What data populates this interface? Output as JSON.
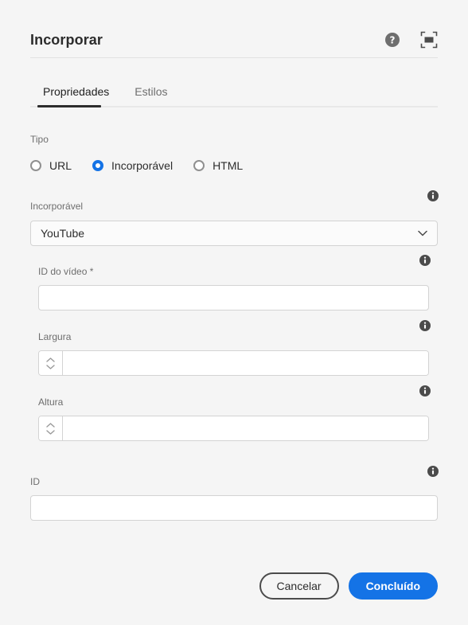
{
  "dialog": {
    "title": "Incorporar",
    "help_icon": "help-circle-icon",
    "fullscreen_icon": "fullscreen-icon"
  },
  "tabs": [
    {
      "label": "Propriedades",
      "active": true
    },
    {
      "label": "Estilos",
      "active": false
    }
  ],
  "type_group": {
    "label": "Tipo",
    "options": [
      {
        "label": "URL",
        "selected": false
      },
      {
        "label": "Incorporável",
        "selected": true
      },
      {
        "label": "HTML",
        "selected": false
      }
    ]
  },
  "fields": {
    "embeddable": {
      "label": "Incorporável",
      "value": "YouTube",
      "chevron": "chevron-down-icon",
      "info": "info-icon"
    },
    "video_id": {
      "label": "ID do vídeo *",
      "value": "",
      "placeholder": "",
      "info": "info-icon"
    },
    "width": {
      "label": "Largura",
      "value": "",
      "placeholder": "",
      "info": "info-icon"
    },
    "height": {
      "label": "Altura",
      "value": "",
      "placeholder": "",
      "info": "info-icon"
    },
    "id": {
      "label": "ID",
      "value": "",
      "placeholder": "",
      "info": "info-icon"
    }
  },
  "footer": {
    "cancel_label": "Cancelar",
    "confirm_label": "Concluído"
  },
  "colors": {
    "accent": "#1473e6",
    "background": "#f5f5f5",
    "text": "#2c2c2c",
    "muted_text": "#6e6e6e",
    "border": "#d3d3d3"
  }
}
